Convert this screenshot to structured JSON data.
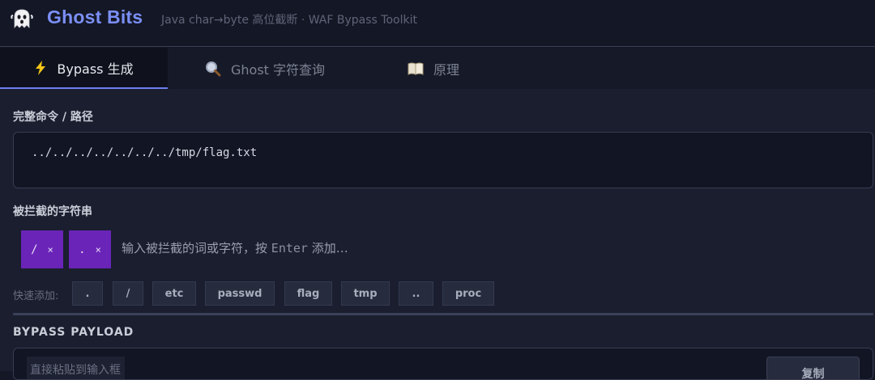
{
  "header": {
    "logo_icon": "ghost-icon",
    "title": "Ghost Bits",
    "subtitle": "Java char→byte 高位截断 · WAF Bypass Toolkit"
  },
  "tabs": [
    {
      "label": "Bypass 生成",
      "icon": "lightning-icon",
      "active": true
    },
    {
      "label": "Ghost 字符查询",
      "icon": "magnifier-icon",
      "active": false
    },
    {
      "label": "原理",
      "icon": "book-icon",
      "active": false
    }
  ],
  "command": {
    "label": "完整命令 / 路径",
    "value": "../../../../../../../tmp/flag.txt"
  },
  "blocked": {
    "label": "被拦截的字符串",
    "chips": [
      {
        "text": "/",
        "remove": "×"
      },
      {
        "text": ".",
        "remove": "×"
      }
    ],
    "placeholder_prefix": "输入被拦截的词或字符，按",
    "placeholder_key": "Enter",
    "placeholder_suffix": "添加…"
  },
  "quick_add": {
    "label": "快速添加:",
    "items": [
      ".",
      "/",
      "etc",
      "passwd",
      "flag",
      "tmp",
      "..",
      "proc"
    ]
  },
  "payload": {
    "label": "BYPASS PAYLOAD",
    "hint": "直接粘贴到输入框",
    "copy_label": "复制"
  },
  "colors": {
    "accent": "#7b8ff5",
    "chip": "#6a24b8",
    "background": "#1a1e2e"
  }
}
